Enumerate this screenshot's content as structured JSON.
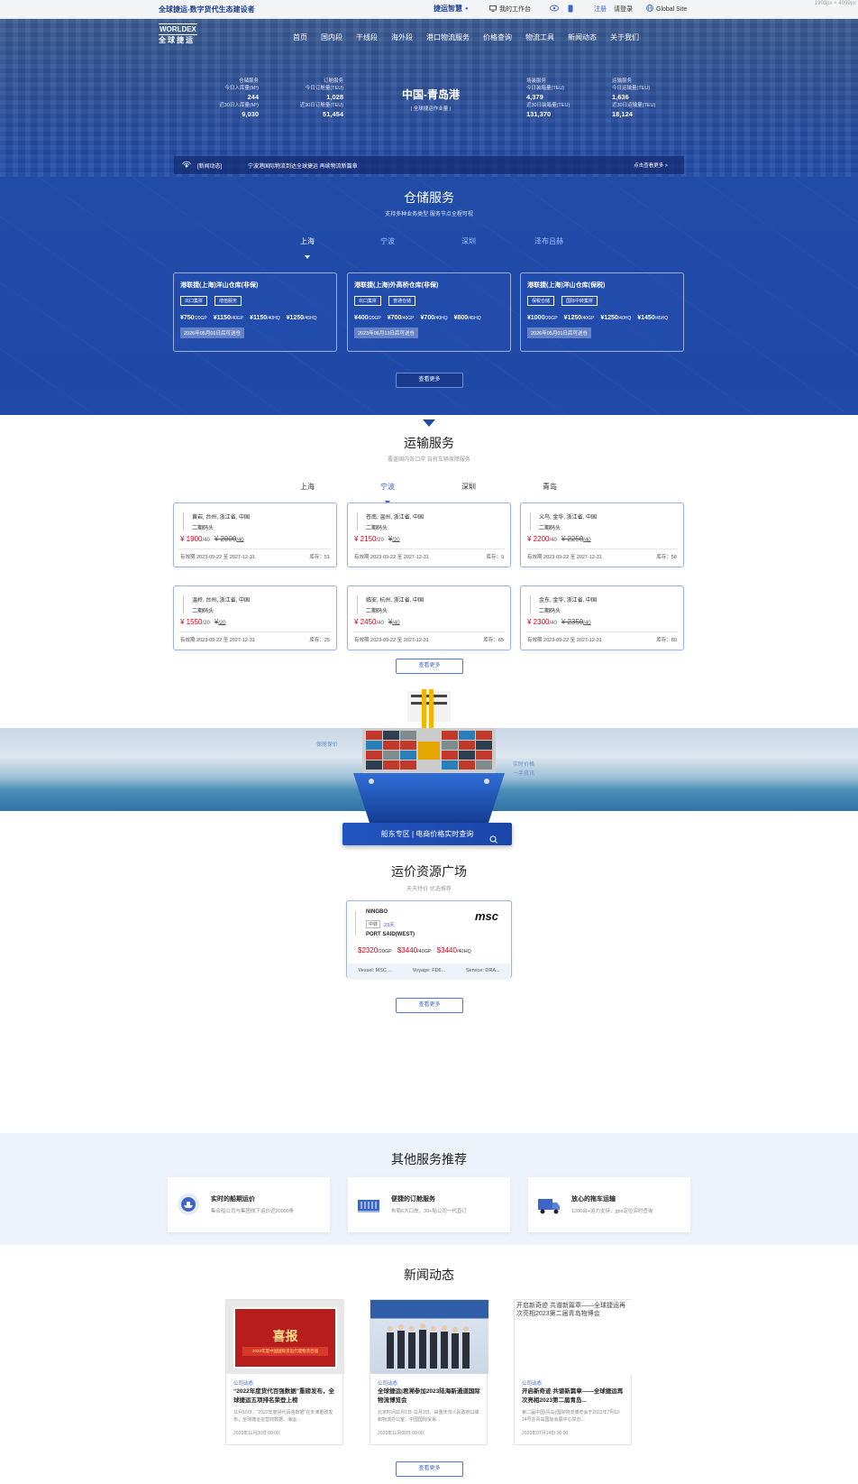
{
  "topbar": {
    "slogan": "全球捷运-数字货代生态建设者",
    "brand": "捷运智慧",
    "workbench": "我的工作台",
    "register": "注册",
    "login": "请登录",
    "global": "Global Site",
    "dimensions": "1903px × 4099px"
  },
  "brand": {
    "logo_en": "WORLDEX",
    "logo_cn": "全球捷运"
  },
  "nav": [
    "首页",
    "国内段",
    "干线段",
    "海外段",
    "港口物流服务",
    "价格查询",
    "物流工具",
    "新闻动态",
    "关于我们"
  ],
  "hero": {
    "port_name": "中国-青岛港",
    "port_sub": "| 全球捷运作业量 |",
    "stats": [
      {
        "title": "仓储服务",
        "l1": "今日入库量(M³)",
        "v1": "244",
        "l2": "近30日入库量(M³)",
        "v2": "9,030"
      },
      {
        "title": "订舱服务",
        "l1": "今日订舱量(TEU)",
        "v1": "1,028",
        "l2": "近30日订舱量(TEU)",
        "v2": "51,454"
      },
      {
        "title": "场装服务",
        "l1": "今日装箱量(TEU)",
        "v1": "4,379",
        "l2": "近30日装箱量(TEU)",
        "v2": "131,370"
      },
      {
        "title": "运输服务",
        "l1": "今日运输量(TEU)",
        "v1": "1,636",
        "l2": "近30日运输量(TEU)",
        "v2": "18,124"
      }
    ],
    "news_label": "[新闻动态]",
    "news_text": "宁波港国际物流到达全球捷运 再续物流新篇章",
    "news_more": "点击查看更多 >"
  },
  "warehouse": {
    "title": "仓储服务",
    "subtitle": "支持多种业务类型 服务节点全程可视",
    "tabs": [
      "上海",
      "宁波",
      "深圳",
      "泽布吕赫"
    ],
    "cards": [
      {
        "name": "港联捷(上海)洋山仓库(非保)",
        "tags": [
          "出口集拼",
          "增值服务"
        ],
        "prices": [
          [
            "¥750",
            "/20GP"
          ],
          [
            "¥1150",
            "/40GP"
          ],
          [
            "¥1150",
            "/40HQ"
          ],
          [
            "¥1250",
            "/45HQ"
          ]
        ],
        "date": "2026年05月01日后可送仓"
      },
      {
        "name": "港联捷(上海)外高桥仓库(非保)",
        "tags": [
          "出口集拼",
          "普通仓储"
        ],
        "prices": [
          [
            "¥400",
            "/20GP"
          ],
          [
            "¥700",
            "/40GP"
          ],
          [
            "¥700",
            "/40HQ"
          ],
          [
            "¥800",
            "/45HQ"
          ]
        ],
        "date": "2023年06月13日后可送仓"
      },
      {
        "name": "港联捷(上海)洋山仓库(保税)",
        "tags": [
          "保税仓储",
          "国际中转集拼"
        ],
        "prices": [
          [
            "¥1000",
            "/20GP"
          ],
          [
            "¥1250",
            "/40GP"
          ],
          [
            "¥1250",
            "/40HQ"
          ],
          [
            "¥1450",
            "/45HQ"
          ]
        ],
        "date": "2026年05月01日后可送仓"
      }
    ],
    "more": "查看更多"
  },
  "transport": {
    "title": "运输服务",
    "subtitle": "覆盖国内各口岸 自有车辆保障服务",
    "tabs": [
      "上海",
      "宁波",
      "深圳",
      "青岛"
    ],
    "cards": [
      {
        "from": "黄岩, 台州, 浙江省, 中国",
        "to": "二期码头",
        "price": "¥ 1900",
        "unit": "/40",
        "old": "¥ 2000",
        "old_unit": "/40",
        "valid": "有效期 2023-09-22 至 2027-12-31",
        "stock": "库存：51"
      },
      {
        "from": "苍南, 温州, 浙江省, 中国",
        "to": "二期码头",
        "price": "¥ 2150",
        "unit": "/20",
        "old": "¥",
        "old_unit": "/20",
        "valid": "有效期 2023-09-22 至 2027-12-31",
        "stock": "库存：9"
      },
      {
        "from": "义乌, 金华, 浙江省, 中国",
        "to": "二期码头",
        "price": "¥ 2200",
        "unit": "/40",
        "old": "¥ 2250",
        "old_unit": "/40",
        "valid": "有效期 2023-09-22 至 2027-12-31",
        "stock": "库存：58"
      },
      {
        "from": "温岭, 台州, 浙江省, 中国",
        "to": "二期码头",
        "price": "¥ 1550",
        "unit": "/20",
        "old": "¥",
        "old_unit": "/20",
        "valid": "有效期 2023-09-22 至 2027-12-31",
        "stock": "库存：25"
      },
      {
        "from": "临安, 杭州, 浙江省, 中国",
        "to": "二期码头",
        "price": "¥ 2450",
        "unit": "/40",
        "old": "¥",
        "old_unit": "/40",
        "valid": "有效期 2023-09-22 至 2027-12-31",
        "stock": "库存：65"
      },
      {
        "from": "金东, 金华, 浙江省, 中国",
        "to": "二期码头",
        "price": "¥ 2300",
        "unit": "/40",
        "old": "¥ 2350",
        "old_unit": "/40",
        "valid": "有效期 2023-09-22 至 2027-12-31",
        "stock": "库存：89"
      }
    ],
    "more": "查看更多"
  },
  "ship": {
    "left_label": "保舱保价",
    "right_label1": "实时价格",
    "right_label2": "一手资讯",
    "query_button": "船东专区 | 电商价格实时查询"
  },
  "freight": {
    "title": "运价资源广场",
    "subtitle": "天天特价 优选推荐",
    "card": {
      "from": "NINGBO",
      "badge": "中转",
      "days": "23天",
      "to": "PORT SAID(WEST)",
      "carrier": "msc",
      "prices": [
        [
          "$2320",
          "/20GP"
        ],
        [
          "$3440",
          "/40GP"
        ],
        [
          "$3440",
          "/40HQ"
        ]
      ],
      "vessel": "Vessel: MSC ...",
      "voyage": "Voyage: FD6...",
      "service": "Service: DRA..."
    },
    "more": "查看更多"
  },
  "other": {
    "title": "其他服务推荐",
    "cards": [
      {
        "icon": "ship-rate-icon",
        "title": "实时的船期运价",
        "desc": "集合船公司与集团线下运价近20000条"
      },
      {
        "icon": "container-icon",
        "title": "便捷的订舱服务",
        "desc": "布局6大口岸，30+船公司一代直订"
      },
      {
        "icon": "truck-icon",
        "title": "放心的拖车运输",
        "desc": "1200台+运力支持，gps定位实时查询"
      }
    ]
  },
  "news": {
    "title": "新闻动态",
    "cards": [
      {
        "cat": "公司动态",
        "title": "“2022年度货代百强数据”重磅发布，全球捷运五项排名荣登上榜",
        "desc": "11月15日，“2022年度货代百强数据”在天津重磅发布，全球捷运在营商数据、海运...",
        "date": "2023年11月20日 00:00",
        "img_main": "喜报",
        "img_sub": "2022年度中国国际货运代理物流百强",
        "img_alt": ""
      },
      {
        "cat": "公司动态",
        "title": "全球捷运|君溯参加2023陆海新通道国际物流博览会",
        "desc": "北京时间11月1日-11月3日，由重庆市人民政府口岸和物流办公室、中国国际贸易...",
        "date": "2023年11月08日 00:00",
        "img_main": "",
        "img_sub": "",
        "img_alt": ""
      },
      {
        "cat": "公司动态",
        "title": "开启新奇迹 共谱新篇章——全球捷运再次亮相2023第二届青岛...",
        "desc": "第二届中国(青岛)国际物流博览会于2023年7月13-14号在青岛国际会展中心举办...",
        "date": "2023年07月14日 00:00",
        "img_main": "",
        "img_sub": "",
        "img_alt": "开启新奇迹 共谱新篇章——全球捷运再次亮相2023第二届青岛物博会"
      }
    ],
    "more": "查看更多"
  },
  "colors": {
    "primary": "#1f4aa8",
    "price_red": "#d0021b",
    "link": "#3c66c8"
  }
}
